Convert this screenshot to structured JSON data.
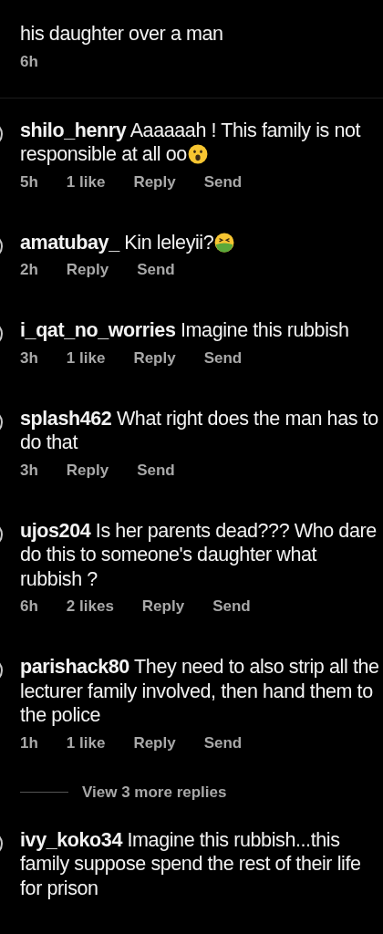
{
  "comments": [
    {
      "text": "his daughter over a man",
      "time": "6h"
    },
    {
      "username": "shilo_henry",
      "text": "Aaaaaah ! This family is not responsible at all oo",
      "emoji": {
        "kind": "surprised"
      },
      "time": "5h",
      "likes": "1 like",
      "actions": [
        "Reply",
        "Send"
      ]
    },
    {
      "username": "amatubay_",
      "text": "Kin leleyii?",
      "emoji": {
        "kind": "nauseated"
      },
      "time": "2h",
      "actions": [
        "Reply",
        "Send"
      ]
    },
    {
      "username": "i_qat_no_worries",
      "text": "Imagine this rubbish",
      "time": "3h",
      "likes": "1 like",
      "actions": [
        "Reply",
        "Send"
      ]
    },
    {
      "username": "splash462",
      "text": "What right does the man has to do that",
      "time": "3h",
      "actions": [
        "Reply",
        "Send"
      ]
    },
    {
      "username": "ujos204",
      "text": "Is her parents dead??? Who dare do this to someone's daughter what rubbish ?",
      "time": "6h",
      "likes": "2 likes",
      "actions": [
        "Reply",
        "Send"
      ]
    },
    {
      "username": "parishack80",
      "text": "They need to also strip all the lecturer family involved, then hand them to the police",
      "time": "1h",
      "likes": "1 like",
      "actions": [
        "Reply",
        "Send"
      ],
      "more_replies": "View 3 more replies"
    },
    {
      "username": "ivy_koko34",
      "text": "Imagine this rubbish...this family suppose spend the rest of their life for prison"
    }
  ]
}
